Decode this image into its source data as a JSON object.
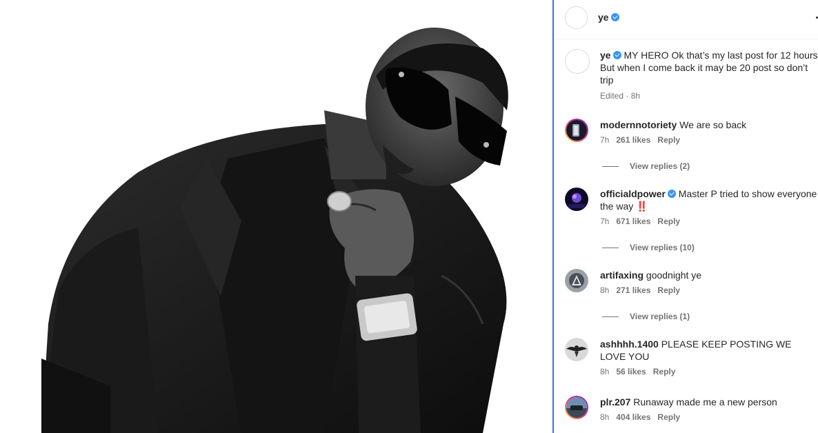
{
  "header": {
    "username": "ye",
    "verified": true,
    "more_icon": "more-options-icon"
  },
  "caption": {
    "username": "ye",
    "verified": true,
    "text": "MY HERO Ok that’s my last post for 12 hours But when I come back it may be 20 post so don’t trip",
    "meta": "Edited · 8h"
  },
  "comments": [
    {
      "username": "modernnotoriety",
      "verified": false,
      "text": "We are so back",
      "time": "7h",
      "likes": "261 likes",
      "reply": "Reply",
      "view_replies": "View replies (2)"
    },
    {
      "username": "officialdpower",
      "verified": true,
      "text": "Master P tried to show everyone the way",
      "emoji": "‼️",
      "time": "7h",
      "likes": "671 likes",
      "reply": "Reply",
      "view_replies": "View replies (10)"
    },
    {
      "username": "artifaxing",
      "verified": false,
      "text": "goodnight ye",
      "time": "8h",
      "likes": "271 likes",
      "reply": "Reply",
      "view_replies": "View replies (1)"
    },
    {
      "username": "ashhhh.1400",
      "verified": false,
      "text": "PLEASE KEEP POSTING WE LOVE YOU",
      "time": "8h",
      "likes": "56 likes",
      "reply": "Reply"
    },
    {
      "username": "plr.207",
      "verified": false,
      "text": "Runaway made me a new person",
      "time": "8h",
      "likes": "404 likes",
      "reply": "Reply"
    }
  ],
  "colors": {
    "accent_border": "#3b6fd6",
    "verified": "#3897f0",
    "secondary_text": "#737373"
  }
}
